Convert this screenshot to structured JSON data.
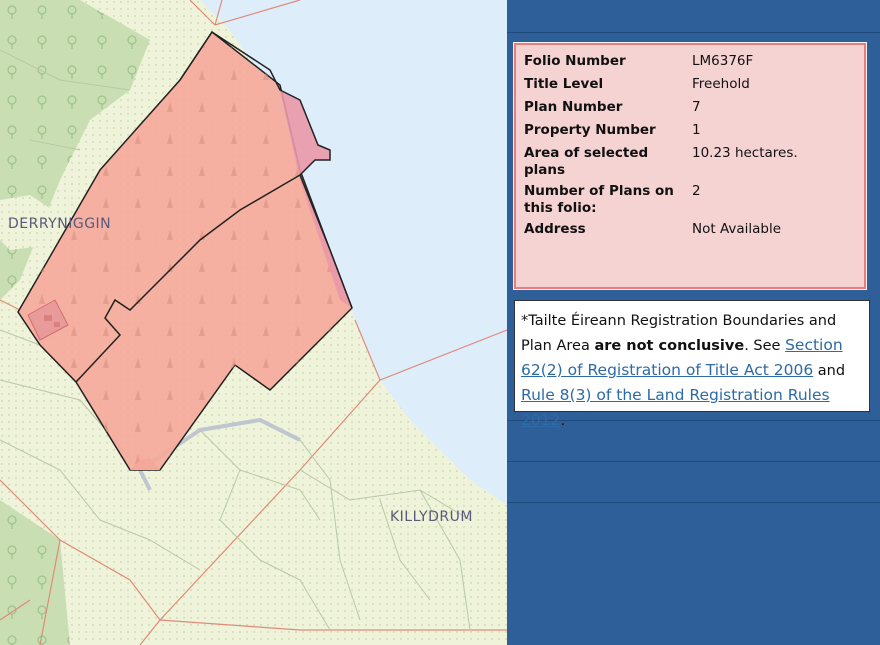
{
  "map": {
    "place_labels": [
      "DERRYNIGGIN",
      "KILLYDRUM"
    ],
    "colors": {
      "land": "#eef3da",
      "woodland": "#c9dfb3",
      "water": "#ddeefa",
      "parcel_fill": "#f5a89a",
      "parcel_border": "#222222",
      "boundary_lines": "#e08a7a"
    }
  },
  "info": {
    "rows": [
      {
        "key": "Folio Number",
        "value": "LM6376F"
      },
      {
        "key": "Title Level",
        "value": "Freehold"
      },
      {
        "key": "Plan Number",
        "value": "7"
      },
      {
        "key": "Property Number",
        "value": "1"
      },
      {
        "key": "Area of selected plans",
        "value": "10.23 hectares."
      },
      {
        "key": "Number of Plans on this folio:",
        "value": "2"
      },
      {
        "key": "Address",
        "value": "Not Available"
      }
    ]
  },
  "note": {
    "part1": "*Tailte Éireann Registration Boundaries and Plan Area ",
    "bold": "are not conclusive",
    "part2": ". See ",
    "link1": "Section 62(2) of Registration of Title Act 2006",
    "part3": " and ",
    "link2": "Rule 8(3) of the Land Registration Rules 2012",
    "part4": "."
  },
  "panel": {
    "background": "#2f5f99"
  }
}
